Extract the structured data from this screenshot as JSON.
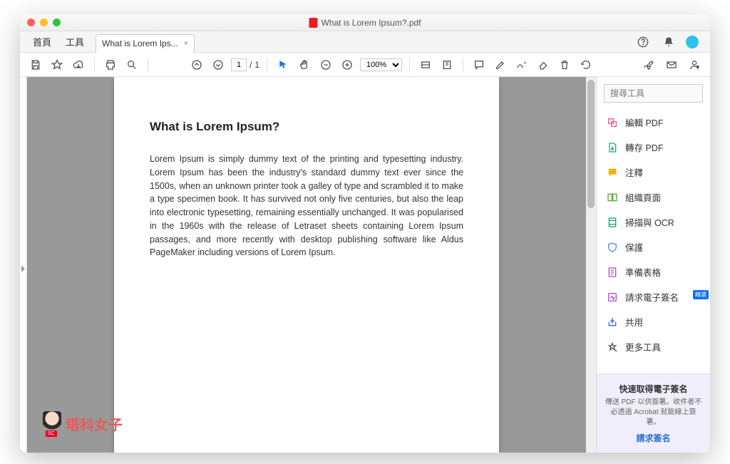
{
  "window": {
    "title": "What is Lorem Ipsum?.pdf"
  },
  "menu": {
    "home": "首頁",
    "tools": "工具"
  },
  "tab": {
    "label": "What is Lorem Ips..."
  },
  "page_nav": {
    "current": "1",
    "total": "1",
    "sep": "/"
  },
  "zoom": {
    "value": "100%"
  },
  "document": {
    "heading": "What is Lorem Ipsum?",
    "body": "Lorem Ipsum is simply dummy text of the printing and typesetting industry. Lorem Ipsum has been the industry's standard dummy text ever since the 1500s, when an unknown printer took a galley of type and scrambled it to make a type specimen book. It has survived not only five centuries, but also the leap into electronic typesetting, remaining essentially unchanged. It was popularised in the 1960s with the release of Letraset sheets containing Lorem Ipsum passages, and more recently with desktop publishing software like Aldus PageMaker including versions of Lorem Ipsum."
  },
  "search": {
    "placeholder": "搜尋工具"
  },
  "tools": [
    {
      "label": "編輯 PDF",
      "color": "#e85a9f",
      "icon": "edit-pdf"
    },
    {
      "label": "轉存 PDF",
      "color": "#1aa889",
      "icon": "export-pdf"
    },
    {
      "label": "注釋",
      "color": "#f4b400",
      "icon": "comment"
    },
    {
      "label": "組織頁面",
      "color": "#5fa843",
      "icon": "organize"
    },
    {
      "label": "掃描與 OCR",
      "color": "#1aa889",
      "icon": "scan-ocr"
    },
    {
      "label": "保護",
      "color": "#4a8dd8",
      "icon": "protect"
    },
    {
      "label": "準備表格",
      "color": "#a855c7",
      "icon": "form"
    },
    {
      "label": "請求電子簽名",
      "color": "#a855c7",
      "icon": "esign",
      "badge": "精選"
    },
    {
      "label": "共用",
      "color": "#2a6bd8",
      "icon": "share"
    },
    {
      "label": "更多工具",
      "color": "#555",
      "icon": "more"
    }
  ],
  "promo": {
    "title": "快速取得電子簽名",
    "body": "傳送 PDF 以供簽署。收件者不必透過 Acrobat 就能線上簽署。",
    "link": "請求簽名"
  },
  "watermark": {
    "badge": "SC",
    "text": "塔科女子"
  }
}
